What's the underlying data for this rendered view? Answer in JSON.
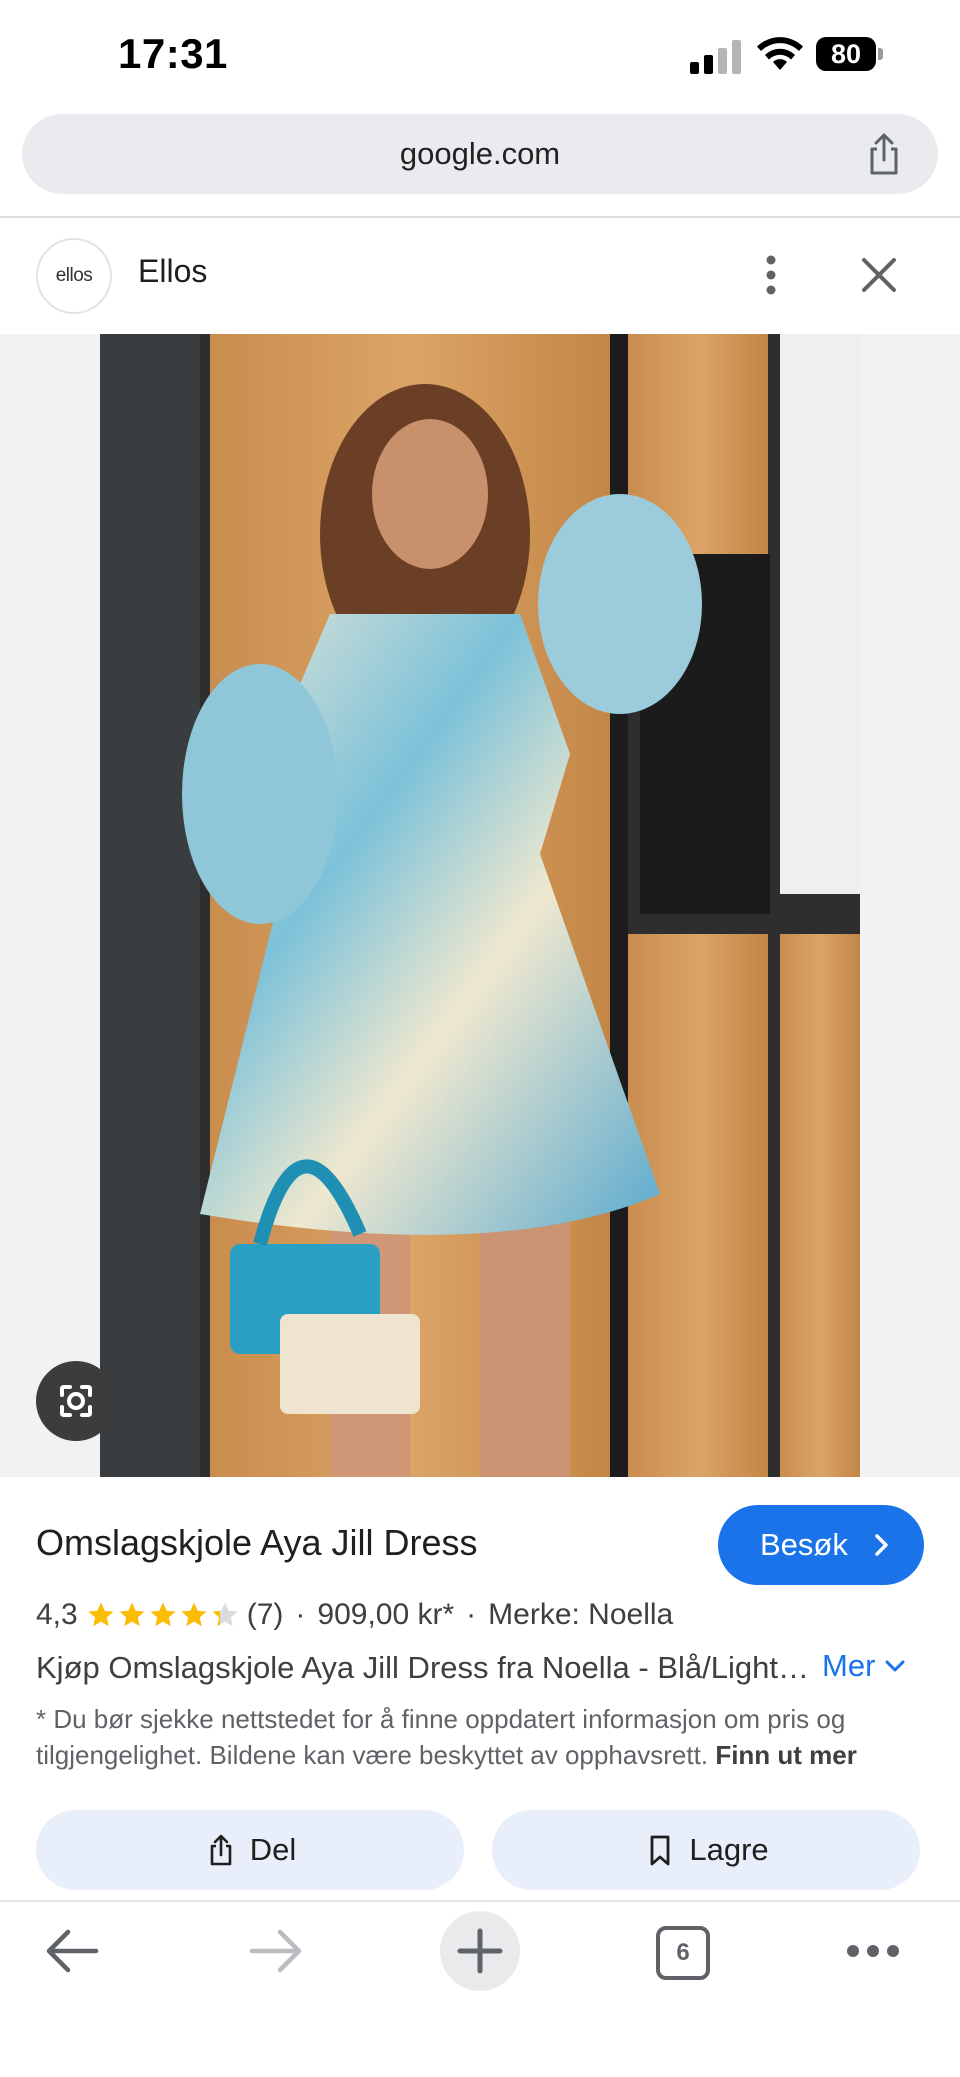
{
  "status_bar": {
    "time": "17:31",
    "battery": "80"
  },
  "browser": {
    "url": "google.com"
  },
  "header": {
    "site_name": "Ellos",
    "logo_text": "ellos"
  },
  "product": {
    "title": "Omslagskjole Aya Jill Dress",
    "visit_label": "Besøk",
    "rating": "4,3",
    "stars_filled": 4.3,
    "reviews": "(7)",
    "sep": "·",
    "price": "909,00 kr*",
    "brand": "Merke: Noella",
    "description": "Kjøp Omslagskjole Aya Jill Dress fra Noella - Blå/Light blue | Ellos.no",
    "more_label": "Mer",
    "note": "* Du bør sjekke nettstedet for å finne oppdatert informasjon om pris og tilgjengelighet. Bildene kan være beskyttet av opphavsrett.",
    "note_link": "Finn ut mer"
  },
  "actions": {
    "share_label": "Del",
    "save_label": "Lagre"
  },
  "toolbar": {
    "tab_count": "6"
  },
  "colors": {
    "accent": "#1a73e8",
    "star": "#fbbc04",
    "button_bg": "#e8effa"
  }
}
